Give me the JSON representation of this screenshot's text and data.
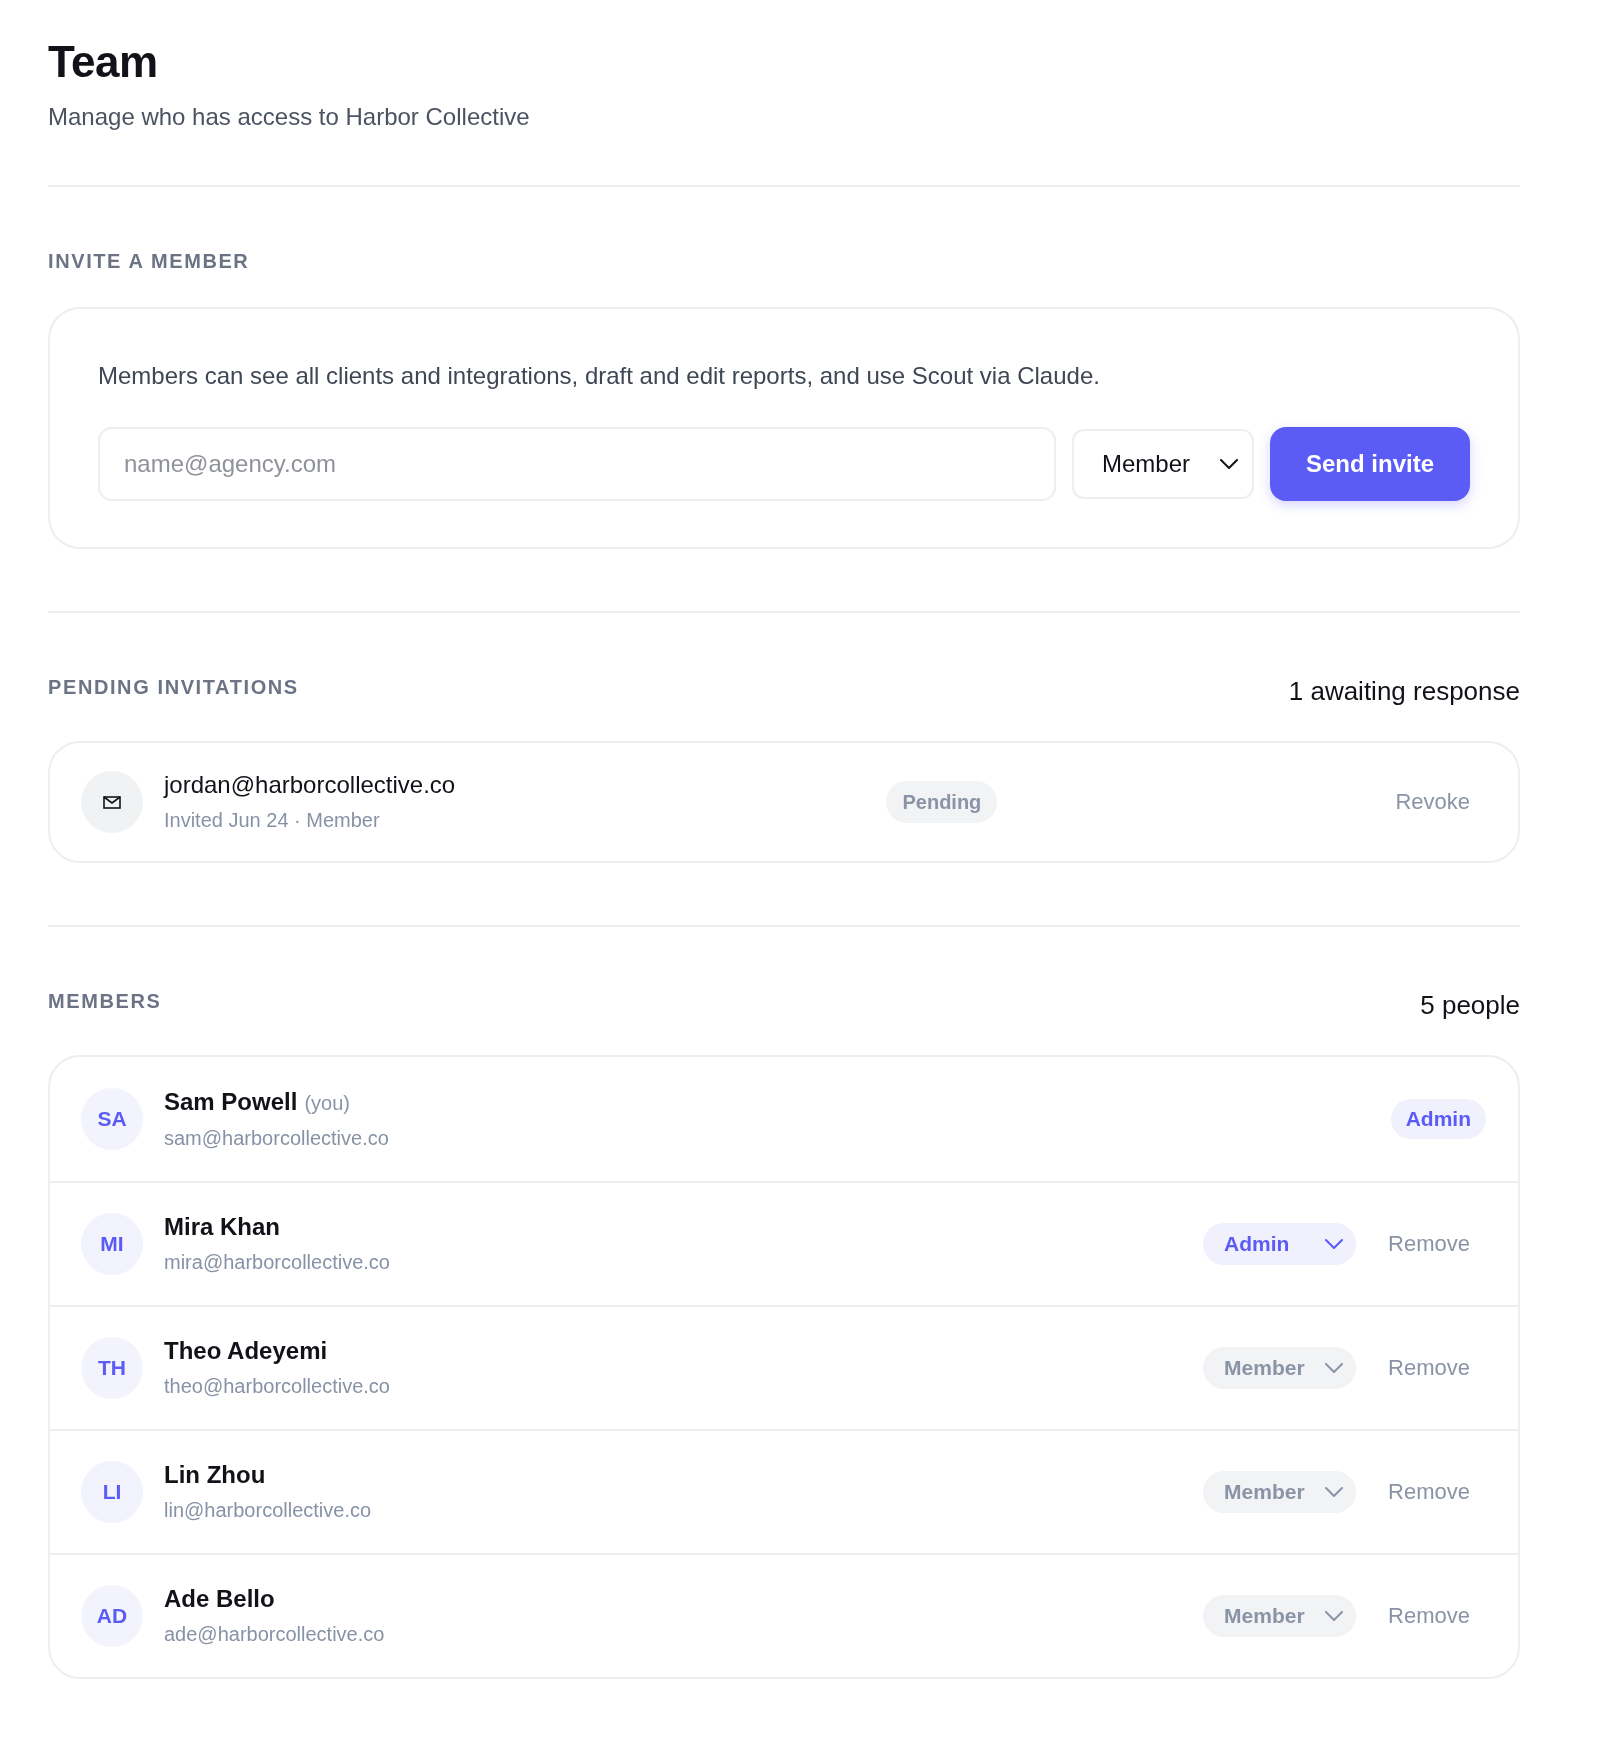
{
  "page": {
    "title": "Team",
    "subtitle": "Manage who has access to Harbor Collective"
  },
  "invite": {
    "heading": "INVITE A MEMBER",
    "description": "Members can see all clients and integrations, draft and edit reports, and use Scout via Claude.",
    "email_field": {
      "placeholder": "name@agency.com"
    },
    "role_select": {
      "value": "Member"
    },
    "send_button": "Send invite"
  },
  "pending": {
    "heading": "PENDING INVITATIONS",
    "count": "1 awaiting response",
    "invitations": [
      {
        "email": "jordan@harborcollective.co",
        "details": "Invited Jun 24 · Member",
        "status": "Pending",
        "action": "Revoke"
      }
    ]
  },
  "members": {
    "heading": "MEMBERS",
    "count": "5 people",
    "rows": [
      {
        "initials": "SA",
        "name": "Sam Powell",
        "note": "(you)",
        "email": "sam@harborcollective.co",
        "role": {
          "kind": "badge",
          "label": "Admin",
          "accent": true
        }
      },
      {
        "initials": "MI",
        "name": "Mira Khan",
        "email": "mira@harborcollective.co",
        "role": {
          "kind": "select",
          "label": "Admin",
          "accent": true
        },
        "action": "Remove"
      },
      {
        "initials": "TH",
        "name": "Theo Adeyemi",
        "email": "theo@harborcollective.co",
        "role": {
          "kind": "select",
          "label": "Member",
          "accent": false
        },
        "action": "Remove"
      },
      {
        "initials": "LI",
        "name": "Lin Zhou",
        "email": "lin@harborcollective.co",
        "role": {
          "kind": "select",
          "label": "Member",
          "accent": false
        },
        "action": "Remove"
      },
      {
        "initials": "AD",
        "name": "Ade Bello",
        "email": "ade@harborcollective.co",
        "role": {
          "kind": "select",
          "label": "Member",
          "accent": false
        },
        "action": "Remove"
      }
    ]
  }
}
